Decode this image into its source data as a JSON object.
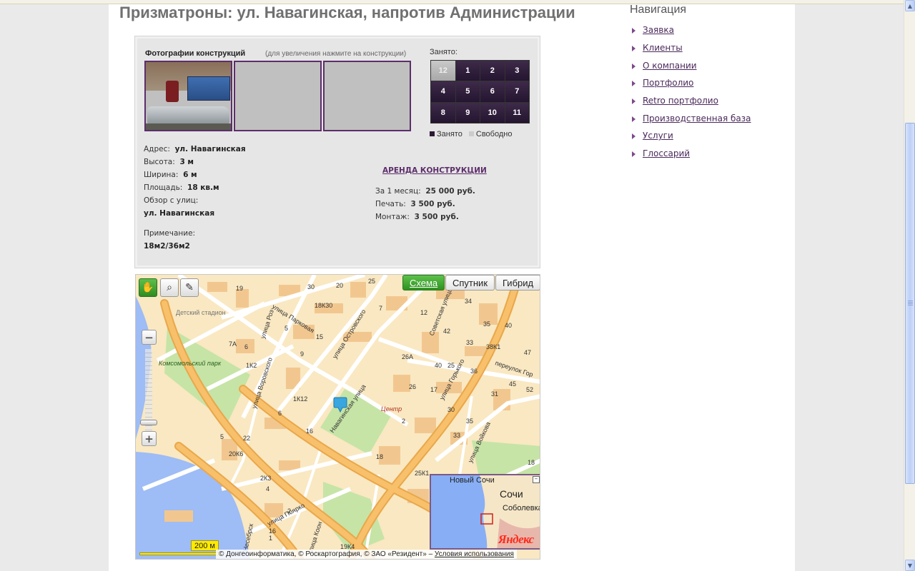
{
  "page": {
    "title": "Призматроны: ул. Навагинская, напротив Администрации"
  },
  "photos": {
    "title": "Фотографии конструкций",
    "hint": "(для увеличения нажмите на конструкции)"
  },
  "occupancy": {
    "label": "Занято:",
    "cells": [
      {
        "label": "12",
        "state": "free"
      },
      {
        "label": "1",
        "state": "busy"
      },
      {
        "label": "2",
        "state": "busy"
      },
      {
        "label": "3",
        "state": "busy"
      },
      {
        "label": "4",
        "state": "busy"
      },
      {
        "label": "5",
        "state": "busy"
      },
      {
        "label": "6",
        "state": "busy"
      },
      {
        "label": "7",
        "state": "busy"
      },
      {
        "label": "8",
        "state": "busy"
      },
      {
        "label": "9",
        "state": "busy"
      },
      {
        "label": "10",
        "state": "busy"
      },
      {
        "label": "11",
        "state": "busy"
      }
    ],
    "legend_busy": "Занято",
    "legend_free": "Свободно"
  },
  "details": {
    "address_label": "Адрес:",
    "address_value": "ул. Навагинская",
    "height_label": "Высота:",
    "height_value": "3 м",
    "width_label": "Ширина:",
    "width_value": "6 м",
    "area_label": "Площадь:",
    "area_value": "18 кв.м",
    "view_label": "Обзор с улиц:",
    "view_value": "ул. Навагинская",
    "note_label": "Примечание:",
    "note_value": "18м2/36м2"
  },
  "rent": {
    "link": "АРЕНДА КОНСТРУКЦИИ",
    "month_label": "За 1 месяц:",
    "month_value": "25 000 руб.",
    "print_label": "Печать:",
    "print_value": "3 500 руб.",
    "mount_label": "Монтаж:",
    "mount_value": "3 500 руб."
  },
  "map": {
    "types": {
      "scheme": "Схема",
      "satellite": "Спутник",
      "hybrid": "Гибрид"
    },
    "scale": "200 м",
    "copyright": "© Донгеоинформатика, © Роскартография, © ЗАО «Резидент» –",
    "terms": "Условия использования",
    "minimap": {
      "city1": "Новый Сочи",
      "city2": "Сочи",
      "area": "Соболевка",
      "brand": "Яндекс"
    },
    "labels": {
      "stadium": "Детский стадион",
      "park": "Комсомольский парк",
      "center": "Центр",
      "street_navaginskaya": "Навагинская улица",
      "street_ostrovskogo": "улица Островского",
      "street_parkovaya": "улица Парковая",
      "street_vorovskogo": "улица Воровского",
      "street_roz": "улица Роз",
      "street_sovetskaya": "Советская улица",
      "street_gorkogo": "улица Горького",
      "street_voykova": "улица Войкова",
      "street_polyarko": "улица Поярко",
      "street_koon": "улица Коон",
      "street_nesebr": "Несебрск",
      "lane_gor": "переулок Гор"
    },
    "numbers": [
      "19",
      "30",
      "20",
      "25",
      "18К30",
      "5",
      "7",
      "12",
      "34",
      "15",
      "42",
      "33",
      "35",
      "40",
      "38К1",
      "47",
      "7А",
      "6",
      "9",
      "3",
      "26А",
      "40",
      "25",
      "36",
      "45",
      "1К2",
      "1К12",
      "26",
      "17",
      "52",
      "5",
      "6",
      "16",
      "31",
      "2",
      "30",
      "35",
      "22",
      "18",
      "20К6",
      "33",
      "2К3",
      "4",
      "16",
      "25К1",
      "18",
      "19К4",
      "2",
      "1"
    ],
    "icons": {
      "hand": "hand-icon",
      "zoom": "magnifier-icon",
      "ruler": "ruler-icon",
      "marker": "map-marker-icon"
    }
  },
  "navigation": {
    "title": "Навигация",
    "items": [
      {
        "label": "Заявка"
      },
      {
        "label": "Клиенты"
      },
      {
        "label": "О компании"
      },
      {
        "label": "Портфолио"
      },
      {
        "label": "Retro портфолио"
      },
      {
        "label": "Производственная база"
      },
      {
        "label": "Услуги"
      },
      {
        "label": "Глоссарий"
      }
    ]
  },
  "colors": {
    "accent": "#5c2e6a",
    "busy": "#2b1a36",
    "free": "#c0c0c0",
    "map_green": "#4db33d",
    "scale_yellow": "#ffea00"
  }
}
